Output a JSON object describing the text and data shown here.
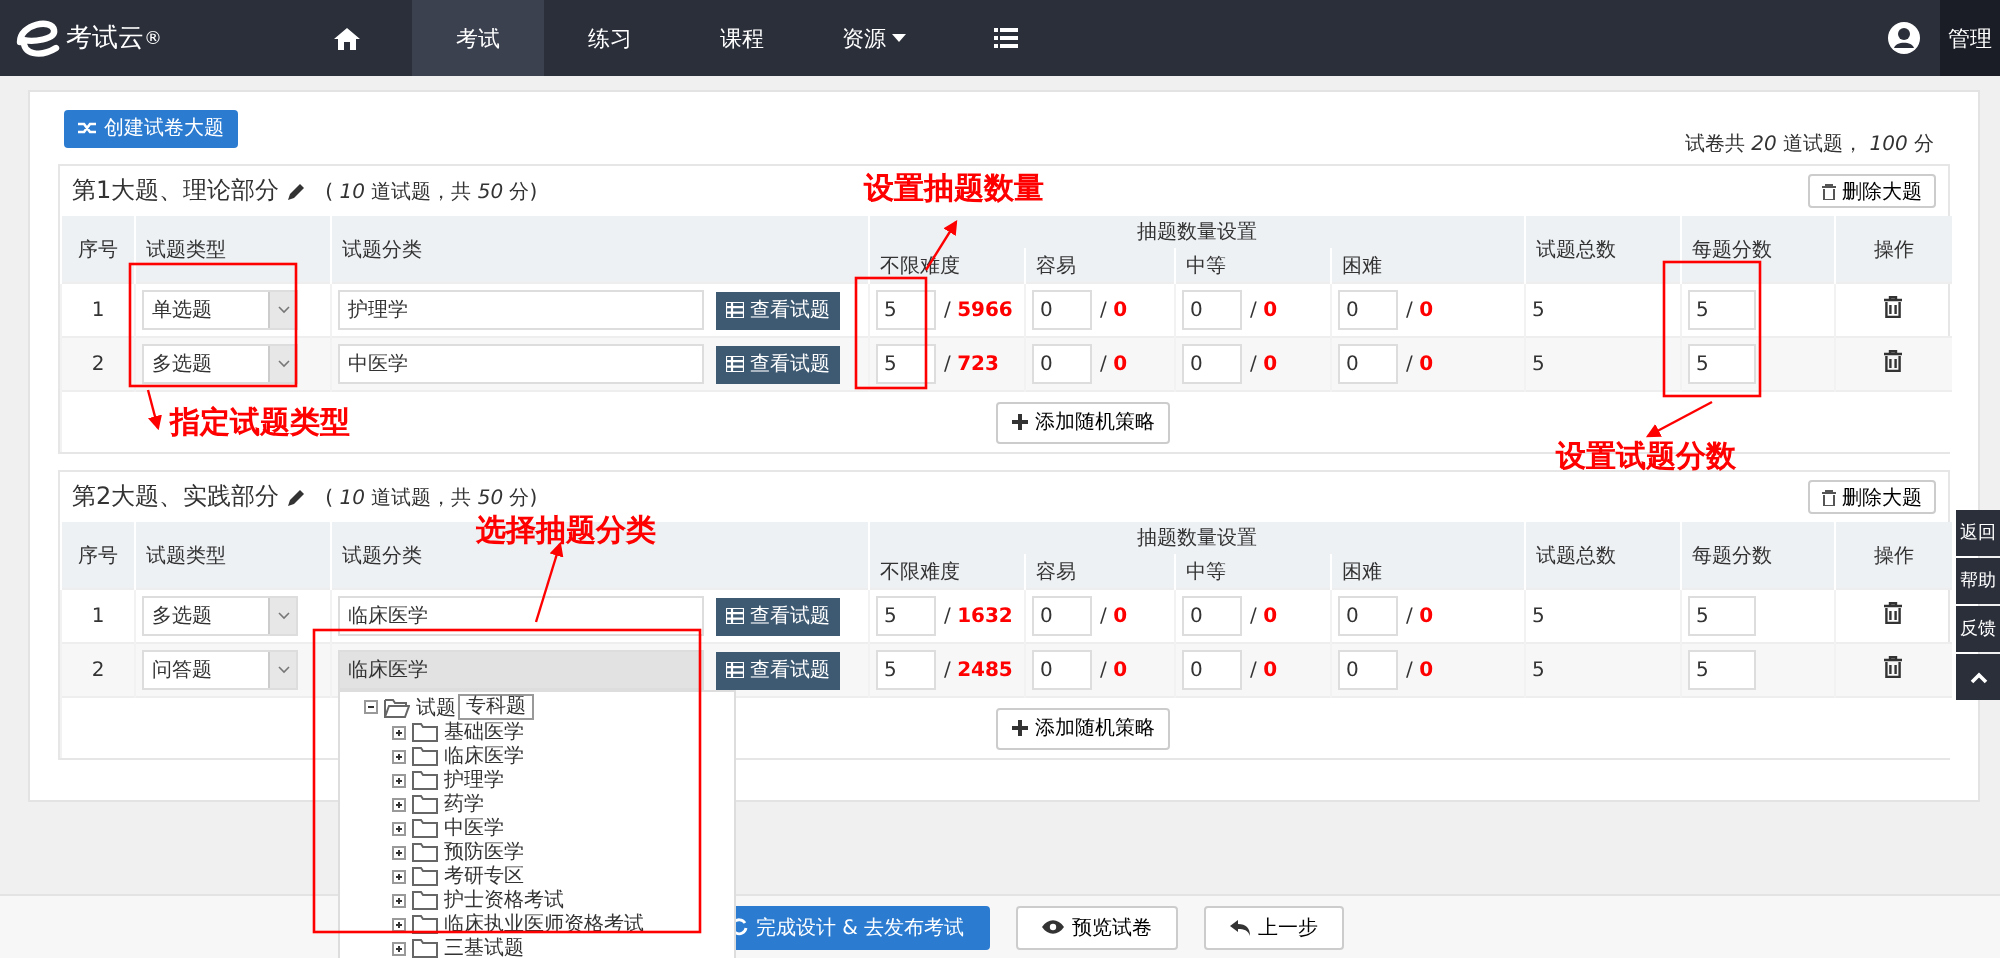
{
  "brand": {
    "name": "考试云",
    "mark": "®"
  },
  "nav": [
    {
      "kind": "home",
      "selected": false
    },
    {
      "kind": "text",
      "label": "考试",
      "selected": true
    },
    {
      "kind": "text",
      "label": "练习",
      "selected": false
    },
    {
      "kind": "text",
      "label": "课程",
      "selected": false
    },
    {
      "kind": "dropdown",
      "label": "资源",
      "selected": false
    },
    {
      "kind": "list",
      "selected": false
    }
  ],
  "user": {
    "label": "管理"
  },
  "create_button": "创建试卷大题",
  "summary": "试卷共 *20* 道试题， *100* 分",
  "sections": [
    {
      "title": "第1大题、理论部分",
      "summary": "( *10* 道试题，共 *50* 分)",
      "delete_button": "删除大题",
      "columns": {
        "index": "序号",
        "type": "试题类型",
        "category": "试题分类",
        "group": "抽题数量设置",
        "levels": [
          "不限难度",
          "容易",
          "中等",
          "困难"
        ],
        "total": "试题总数",
        "score": "每题分数",
        "action": "操作"
      },
      "rows": [
        {
          "index": "1",
          "type": "单选题",
          "category": "护理学",
          "focused": false,
          "view_button": "查看试题",
          "counts": [
            {
              "value": "5",
              "max": "/ **5966**"
            },
            {
              "value": "0",
              "max": "/ **0**"
            },
            {
              "value": "0",
              "max": "/ **0**"
            },
            {
              "value": "0",
              "max": "/ **0**"
            }
          ],
          "total": "5",
          "score": "5"
        },
        {
          "index": "2",
          "type": "多选题",
          "category": "中医学",
          "focused": false,
          "view_button": "查看试题",
          "counts": [
            {
              "value": "5",
              "max": "/ **723**"
            },
            {
              "value": "0",
              "max": "/ **0**"
            },
            {
              "value": "0",
              "max": "/ **0**"
            },
            {
              "value": "0",
              "max": "/ **0**"
            }
          ],
          "total": "5",
          "score": "5"
        }
      ],
      "add_button": "添加随机策略"
    },
    {
      "title": "第2大题、实践部分",
      "summary": "( *10* 道试题，共 *50* 分)",
      "delete_button": "删除大题",
      "columns": {
        "index": "序号",
        "type": "试题类型",
        "category": "试题分类",
        "group": "抽题数量设置",
        "levels": [
          "不限难度",
          "容易",
          "中等",
          "困难"
        ],
        "total": "试题总数",
        "score": "每题分数",
        "action": "操作"
      },
      "rows": [
        {
          "index": "1",
          "type": "多选题",
          "category": "临床医学",
          "focused": false,
          "view_button": "查看试题",
          "counts": [
            {
              "value": "5",
              "max": "/ **1632**"
            },
            {
              "value": "0",
              "max": "/ **0**"
            },
            {
              "value": "0",
              "max": "/ **0**"
            },
            {
              "value": "0",
              "max": "/ **0**"
            }
          ],
          "total": "5",
          "score": "5"
        },
        {
          "index": "2",
          "type": "问答题",
          "category": "临床医学",
          "focused": true,
          "view_button": "查看试题",
          "counts": [
            {
              "value": "5",
              "max": "/ **2485**"
            },
            {
              "value": "0",
              "max": "/ **0**"
            },
            {
              "value": "0",
              "max": "/ **0**"
            },
            {
              "value": "0",
              "max": "/ **0**"
            }
          ],
          "total": "5",
          "score": "5",
          "tree": {
            "tooltip": "专科题",
            "root": {
              "label": "试题",
              "expanded": true,
              "children": [
                {
                  "label": "基础医学",
                  "expanded": false
                },
                {
                  "label": "临床医学",
                  "expanded": false
                },
                {
                  "label": "护理学",
                  "expanded": false
                },
                {
                  "label": "药学",
                  "expanded": false
                },
                {
                  "label": "中医学",
                  "expanded": false
                },
                {
                  "label": "预防医学",
                  "expanded": false
                },
                {
                  "label": "考研专区",
                  "expanded": false
                },
                {
                  "label": "护士资格考试",
                  "expanded": false
                },
                {
                  "label": "临床执业医师资格考试",
                  "expanded": false
                },
                {
                  "label": "三基试题",
                  "expanded": false
                }
              ]
            }
          }
        }
      ],
      "add_button": "添加随机策略"
    }
  ],
  "footer_buttons": [
    {
      "kind": "primary",
      "label": "完成设计 & 去发布考试"
    },
    {
      "kind": "preview",
      "label": "预览试卷"
    },
    {
      "kind": "back",
      "label": "上一步"
    }
  ],
  "side_buttons": [
    {
      "kind": "text",
      "label": "返回"
    },
    {
      "kind": "text",
      "label": "帮助"
    },
    {
      "kind": "text",
      "label": "反馈"
    },
    {
      "kind": "top"
    }
  ],
  "annotations": [
    {
      "text": "设置抽题数量"
    },
    {
      "text": "指定试题类型"
    },
    {
      "text": "设置试题分数"
    },
    {
      "text": "选择抽题分类"
    }
  ]
}
